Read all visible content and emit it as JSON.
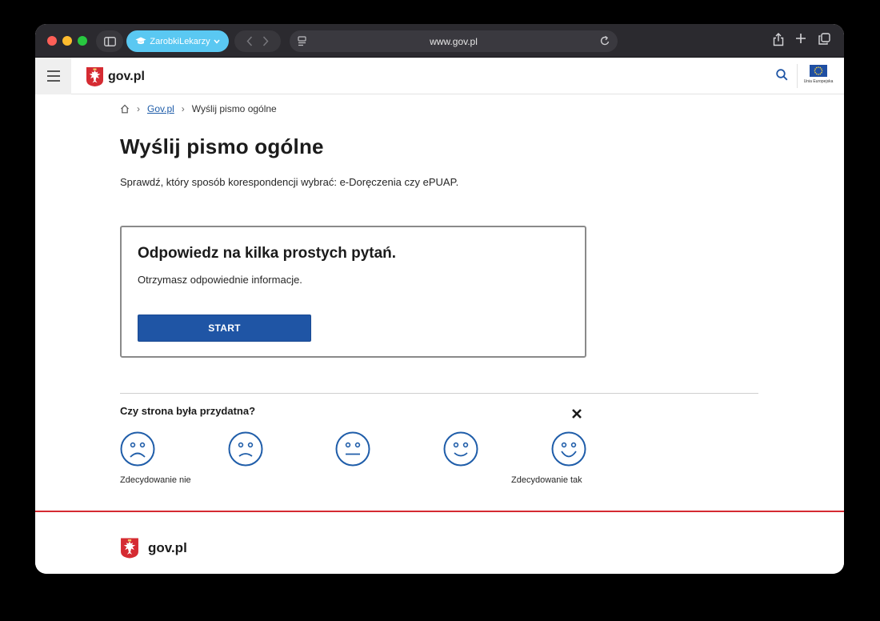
{
  "browser": {
    "profile_label": "ZarobkiLekarzy",
    "url": "www.gov.pl"
  },
  "header": {
    "logo_text": "gov.pl",
    "eu_caption": "Unia Europejska"
  },
  "breadcrumb": {
    "link": "Gov.pl",
    "current": "Wyślij pismo ogólne"
  },
  "page": {
    "title": "Wyślij pismo ogólne",
    "lead": "Sprawdź, który sposób korespondencji wybrać: e-Doręczenia czy ePUAP."
  },
  "card": {
    "title": "Odpowiedz na kilka prostych pytań.",
    "text": "Otrzymasz odpowiednie informacje.",
    "button": "START"
  },
  "feedback": {
    "question": "Czy strona była przydatna?",
    "label_left": "Zdecydowanie nie",
    "label_right": "Zdecydowanie tak",
    "faces": [
      "very-sad",
      "sad",
      "neutral",
      "happy",
      "very-happy"
    ]
  },
  "footer": {
    "logo_text": "gov.pl"
  },
  "colors": {
    "accent": "#1f55a5",
    "link": "#1f5da9",
    "footer_line": "#d52b32",
    "face_stroke": "#1f5da9"
  }
}
